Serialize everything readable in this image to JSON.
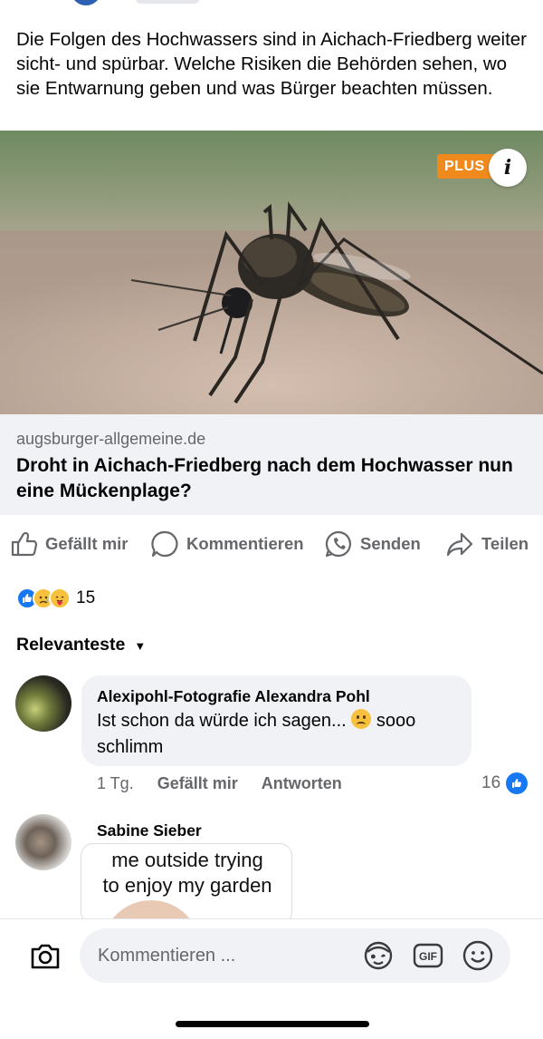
{
  "post": {
    "text": "Die Folgen des Hochwassers sind in Aichach-Friedberg weiter sicht- und spürbar. Welche Risiken die Behörden sehen, wo sie Entwarnung geben und was Bürger beachten müssen."
  },
  "link": {
    "badge": "PLUS",
    "info_icon_glyph": "i",
    "domain": "augsburger-allgemeine.de",
    "title": "Droht in Aichach-Friedberg nach dem Hochwasser nun eine Mückenplage?"
  },
  "actions": [
    {
      "label": "Gefällt mir",
      "icon": "like-icon"
    },
    {
      "label": "Kommentieren",
      "icon": "comment-icon"
    },
    {
      "label": "Senden",
      "icon": "whatsapp-icon"
    },
    {
      "label": "Teilen",
      "icon": "share-icon"
    }
  ],
  "reactions": {
    "icons": [
      "like",
      "sad",
      "care"
    ],
    "count": "15"
  },
  "comments_sort": {
    "label": "Relevanteste"
  },
  "comments": [
    {
      "author": "Alexipohl-Fotografie Alexandra Pohl",
      "text_before_emoji": "Ist schon da würde ich sagen...",
      "emoji": "confused-face",
      "text_after_emoji": "sooo schlimm",
      "time": "1 Tg.",
      "like_label": "Gefällt mir",
      "reply_label": "Antworten",
      "like_count": "16"
    },
    {
      "author": "Sabine Sieber",
      "meme_text_line1": "me outside trying",
      "meme_text_line2": "to enjoy my garden"
    }
  ],
  "composer": {
    "placeholder": "Kommentieren ...",
    "icons": [
      "camera-icon",
      "avatar-sticker-icon",
      "gif-icon",
      "emoji-icon"
    ]
  },
  "colors": {
    "brand_blue": "#1877f2",
    "plus_orange": "#f08a1d",
    "secondary_text": "#65676b",
    "bubble_bg": "#f0f2f5"
  }
}
